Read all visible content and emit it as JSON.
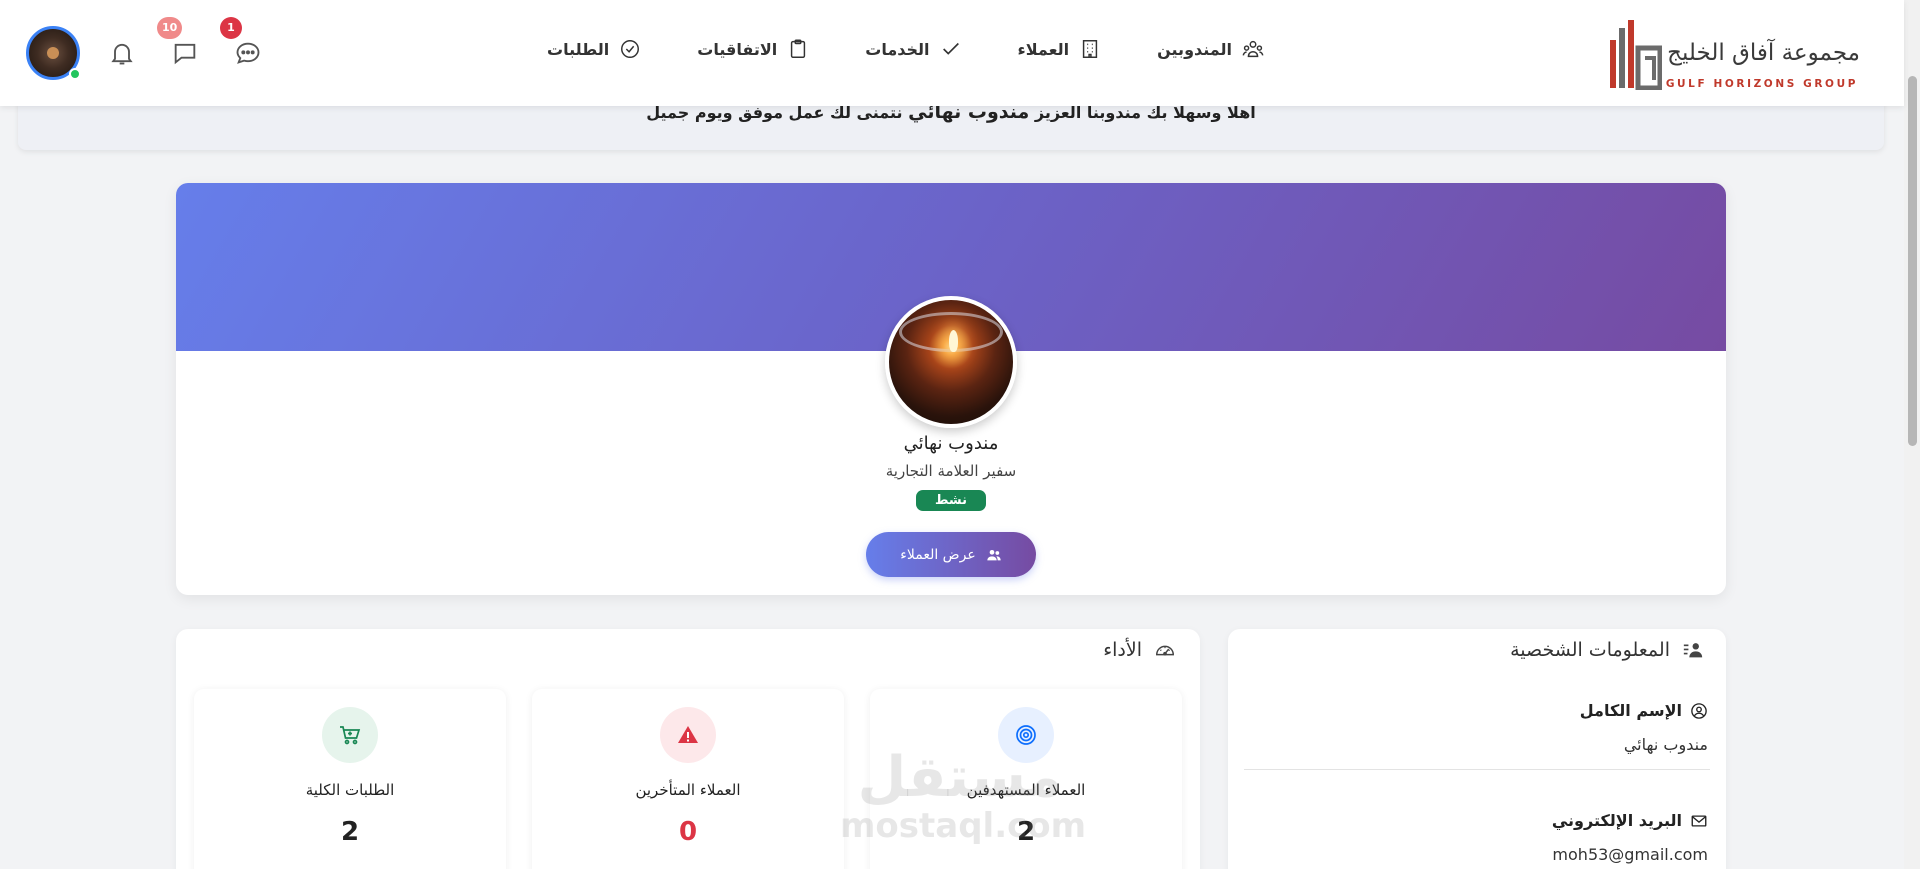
{
  "brand": {
    "name_ar": "مجموعة آفاق الخليج",
    "name_en": "GULF HORIZONS GROUP",
    "colors": {
      "accent": "#c0392b",
      "mark_gray": "#6b6b6b"
    }
  },
  "nav": {
    "items": [
      {
        "label": "المندوبين",
        "icon": "people-icon"
      },
      {
        "label": "العملاء",
        "icon": "building-icon"
      },
      {
        "label": "الخدمات",
        "icon": "check-icon"
      },
      {
        "label": "الاتفاقيات",
        "icon": "clipboard-icon"
      },
      {
        "label": "الطلبات",
        "icon": "check-circle-icon"
      }
    ]
  },
  "header_icons": {
    "chat_badge": "1",
    "messages_badge": "10",
    "avatar_status": "online"
  },
  "welcome": {
    "prefix": "اهلا وسهلا بك مندوبنا العزيز",
    "name": "مندوب نهائي",
    "suffix": "نتمنى لك عمل موفق ويوم جميل"
  },
  "profile": {
    "name": "مندوب نهائي",
    "role": "سفير العلامة التجارية",
    "status": "نشط",
    "view_clients_label": "عرض العملاء",
    "colors": {
      "cover_start": "#667eea",
      "cover_end": "#764ba2",
      "status": "#198754"
    }
  },
  "performance": {
    "title": "الأداء",
    "stats": [
      {
        "label": "العملاء المستهدفين",
        "value": "2",
        "icon": "target-icon",
        "color": "#0d6efd"
      },
      {
        "label": "العملاء المتأخرين",
        "value": "0",
        "icon": "warning-icon",
        "color": "#dc3545"
      },
      {
        "label": "الطلبات الكلية",
        "value": "2",
        "icon": "cart-icon",
        "color": "#198754"
      }
    ]
  },
  "personal_info": {
    "title": "المعلومات الشخصية",
    "full_name_label": "الإسم الكامل",
    "full_name_value": "مندوب نهائي",
    "email_label": "البريد الإلكتروني",
    "email_value": "moh53@gmail.com"
  },
  "watermark": {
    "ar": "مستقل",
    "en": "mostaql.com"
  }
}
